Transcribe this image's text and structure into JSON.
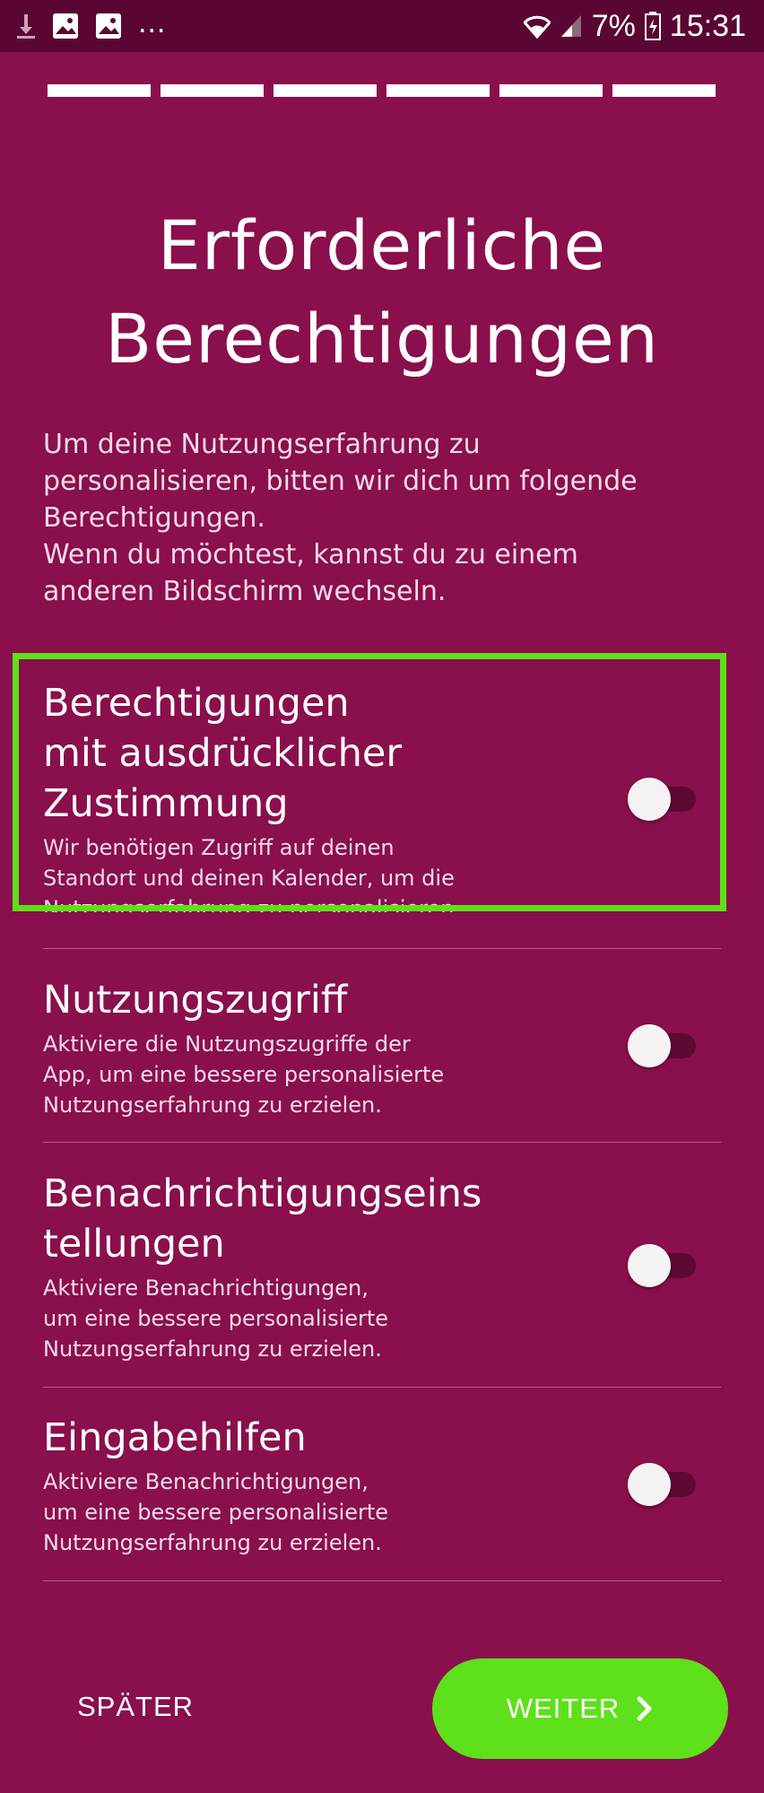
{
  "status_bar": {
    "left_icons": [
      "download-icon",
      "image-icon",
      "image-icon"
    ],
    "overflow": "...",
    "battery_percent": "7%",
    "time": "15:31"
  },
  "progress": {
    "total_steps": 6,
    "completed_steps": 6
  },
  "title": "Erforderliche\nBerechtigungen",
  "intro": "Um deine Nutzungserfahrung zu\npersonalisieren, bitten wir dich um folgende\nBerechtigungen.\nWenn du möchtest, kannst du zu einem\nanderen Bildschirm wechseln.",
  "permissions": [
    {
      "title": "Berechtigungen\nmit ausdrücklicher\nZustimmung",
      "description": "Wir benötigen Zugriff auf deinen\nStandort und deinen Kalender, um die\nNutzungserfahrung zu personalisieren.",
      "enabled": false
    },
    {
      "title": "Nutzungszugriff",
      "description": "Aktiviere die Nutzungszugriffe der\nApp, um eine bessere personalisierte\nNutzungserfahrung zu erzielen.",
      "enabled": false
    },
    {
      "title": "Benachrichtigungseins\ntellungen",
      "description": "Aktiviere Benachrichtigungen,\num eine bessere personalisierte\nNutzungserfahrung zu erzielen.",
      "enabled": false
    },
    {
      "title": "Eingabehilfen",
      "description": "Aktiviere Benachrichtigungen,\num eine bessere personalisierte\nNutzungserfahrung zu erzielen.",
      "enabled": false
    }
  ],
  "footer": {
    "later_label": "SPÄTER",
    "next_label": "WEITER"
  },
  "colors": {
    "background": "#8a0f4d",
    "status_bar": "#5a0632",
    "accent_green": "#5ee01a",
    "toggle_track": "#5c0a33"
  }
}
